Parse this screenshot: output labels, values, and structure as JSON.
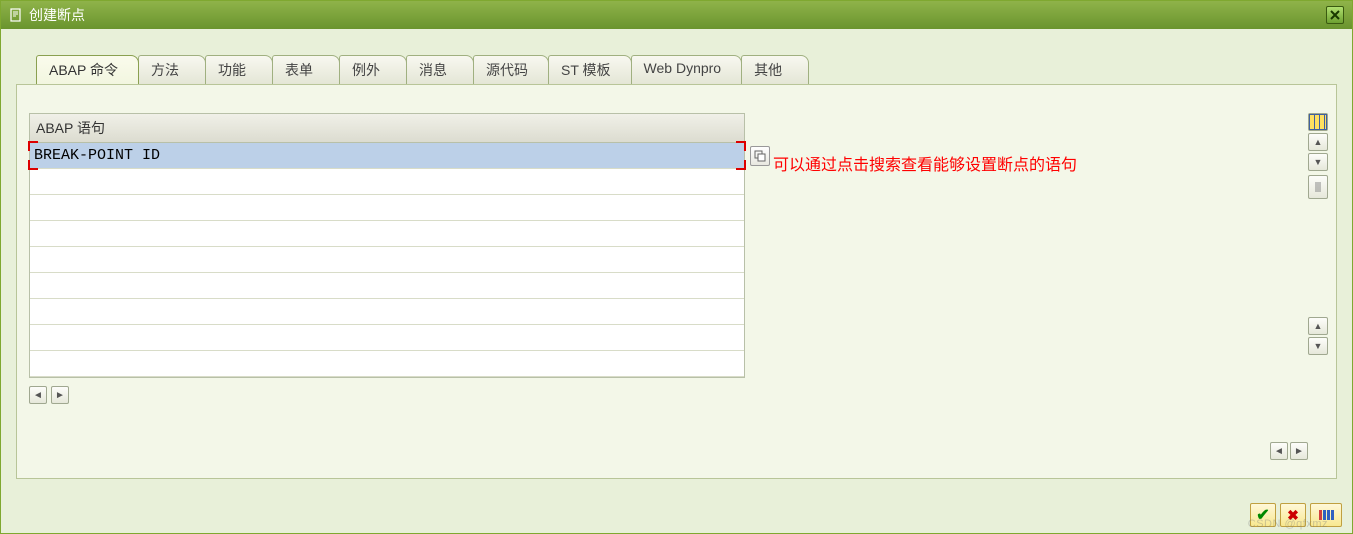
{
  "window": {
    "title": "创建断点"
  },
  "tabs": [
    {
      "label": "ABAP 命令",
      "active": true
    },
    {
      "label": "方法",
      "active": false
    },
    {
      "label": "功能",
      "active": false
    },
    {
      "label": "表单",
      "active": false
    },
    {
      "label": "例外",
      "active": false
    },
    {
      "label": "消息",
      "active": false
    },
    {
      "label": "源代码",
      "active": false
    },
    {
      "label": "ST 模板",
      "active": false
    },
    {
      "label": "Web Dynpro",
      "active": false
    },
    {
      "label": "其他",
      "active": false
    }
  ],
  "table": {
    "header": "ABAP 语句",
    "input_value": "BREAK-POINT ID",
    "empty_rows": 8
  },
  "annotation": "可以通过点击搜索查看能够设置断点的语句",
  "icons": {
    "title_icon": "document-icon",
    "close": "×",
    "f4": "search-help",
    "scroll_left": "◄",
    "scroll_right": "►",
    "arrow_up": "▲",
    "arrow_down": "▼",
    "check": "✔",
    "cancel": "✖"
  },
  "watermark": "CSDN @qfxmz"
}
